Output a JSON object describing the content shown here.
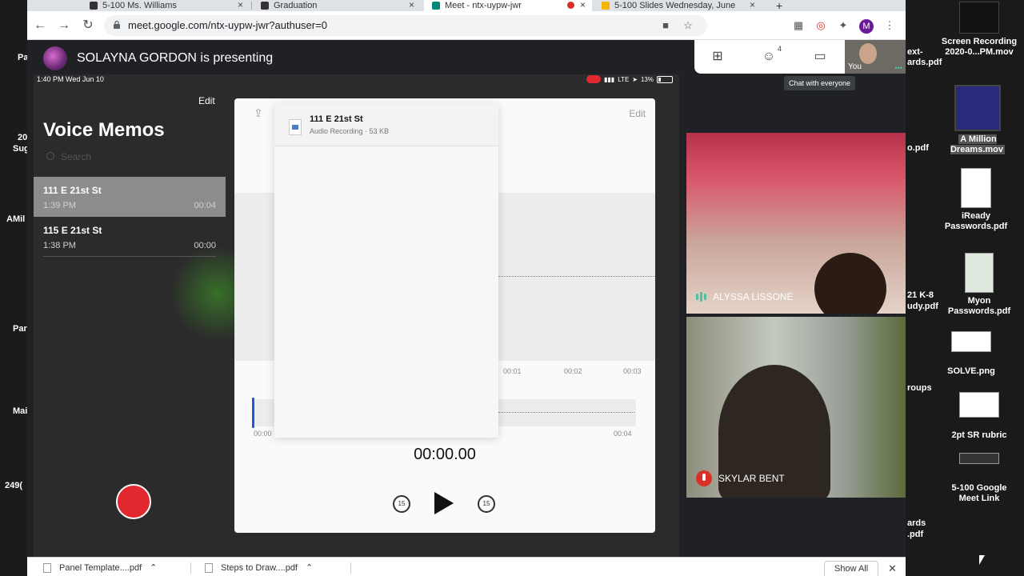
{
  "browser": {
    "tabs": [
      {
        "label": "5-100 Ms. Williams"
      },
      {
        "label": "Graduation"
      },
      {
        "label": "Meet - ntx-uypw-jwr"
      },
      {
        "label": "5-100 Slides Wednesday, June"
      }
    ],
    "new_tab": "+",
    "url": "meet.google.com/ntx-uypw-jwr?authuser=0",
    "profile_initial": "M"
  },
  "meet": {
    "presenter_text": "SOLAYNA GORDON is presenting",
    "people_count": "4",
    "self_label": "You",
    "tooltip": "Chat with everyone",
    "participants": [
      {
        "name": "ALYSSA LISSONE"
      },
      {
        "name": "SKYLAR BENT"
      }
    ]
  },
  "ipad": {
    "status_time": "1:40 PM  Wed Jun 10",
    "status_right": "LTE",
    "battery": "13%",
    "sidebar_edit": "Edit",
    "app_title": "Voice Memos",
    "search_placeholder": "Search",
    "memos": [
      {
        "title": "111 E 21st St",
        "date": "1:39 PM",
        "duration": "00:04"
      },
      {
        "title": "115 E 21st St",
        "date": "1:38 PM",
        "duration": "00:00"
      }
    ],
    "detail_edit": "Edit",
    "share": {
      "file_name": "111 E 21st St",
      "file_meta": "Audio Recording · 53 KB"
    },
    "time_ticks": [
      "00:01",
      "00:02",
      "00:03"
    ],
    "scrub_start": "00:00",
    "scrub_end": "00:04",
    "current_time": "00:00.00",
    "skip_back": "15",
    "skip_forward": "15"
  },
  "downloads": {
    "items": [
      {
        "label": "Panel Template....pdf"
      },
      {
        "label": "Steps to Draw....pdf"
      }
    ],
    "show_all": "Show All",
    "close": "✕"
  },
  "desktop": {
    "left_labels": [
      "Pa",
      "20",
      "Sug",
      "AMil",
      "Par",
      "Mai",
      "249("
    ],
    "right_icons": [
      {
        "label": "Screen Recording 2020-0...PM.mov"
      },
      {
        "label": "A Million Dreams.mov"
      },
      {
        "label": "iReady Passwords.pdf"
      },
      {
        "label": "Myon Passwords.pdf"
      },
      {
        "label": "SOLVE.png"
      },
      {
        "label": "2pt SR rubric"
      },
      {
        "label": "5-100 Google Meet Link"
      }
    ],
    "cut_labels": [
      "ext-",
      "ards.pdf",
      "o.pdf",
      "21 K-8",
      "udy.pdf",
      "roups",
      "ards",
      ".pdf"
    ]
  }
}
